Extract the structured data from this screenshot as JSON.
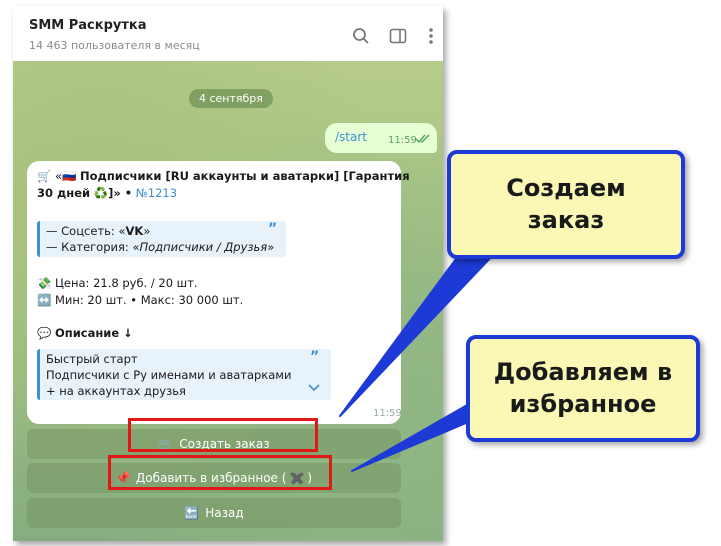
{
  "header": {
    "title": "SMM Раскрутка",
    "subtitle": "14 463 пользователя в месяц",
    "icons": [
      "search-icon",
      "sidebar-icon",
      "more-icon"
    ]
  },
  "chat": {
    "date": "4 сентября",
    "outgoing": {
      "text": "/start",
      "time": "11:59"
    },
    "incoming": {
      "title_line1_prefix": "«",
      "title_line1": "Подписчики [RU аккаунты и аватарки] [Гарантия",
      "title_line2": "30 дней",
      "title_line2_suffix": "]» •",
      "order_id": "№1213",
      "quote1_line1_label": "— Соцсеть: «",
      "quote1_line1_value": "VK",
      "quote1_line1_end": "»",
      "quote1_line2_label": "— Категория: «",
      "quote1_line2_value": "Подписчики / Друзья",
      "quote1_line2_end": "»",
      "price": "Цена: 21.8 руб. / 20 шт.",
      "minmax": "Мин: 20 шт. • Макс: 30 000 шт.",
      "description_label": "Описание ↓",
      "quote2_line1": "Быстрый старт",
      "quote2_line2": "Подписчики с Ру именами и аватарками",
      "quote2_line3": "+ на аккаунтах друзья",
      "time": "11:59"
    }
  },
  "keyboard": {
    "create_order": "Создать заказ",
    "add_favorite": "Добавить в избранное (",
    "add_favorite_end": ")",
    "back": "Назад"
  },
  "callouts": {
    "create": "Создаем заказ",
    "favorite": "Добавляем в избранное"
  },
  "colors": {
    "accent": "#3f8fd2",
    "highlight": "#e01818",
    "callout_border": "#1d3ad6",
    "callout_fill": "#fbf7b5"
  }
}
